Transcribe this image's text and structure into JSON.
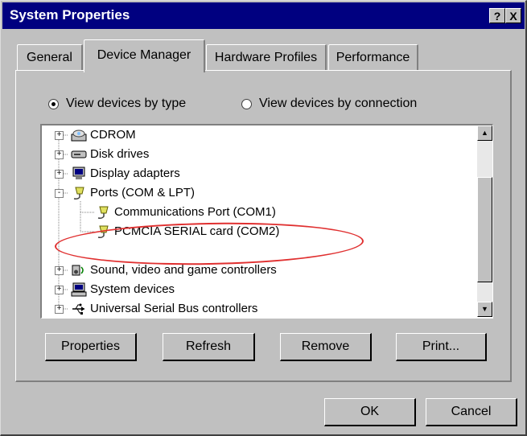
{
  "window": {
    "title": "System Properties"
  },
  "titlebar_buttons": {
    "help": "?",
    "close": "X"
  },
  "tabs": [
    "General",
    "Device Manager",
    "Hardware Profiles",
    "Performance"
  ],
  "view_options": {
    "by_type": "View devices by type",
    "by_connection": "View devices by connection",
    "selected": "by_type"
  },
  "tree": {
    "items": [
      {
        "label": "CDROM",
        "icon": "cdrom-icon",
        "expander": "+"
      },
      {
        "label": "Disk drives",
        "icon": "disk-drive-icon",
        "expander": "+"
      },
      {
        "label": "Display adapters",
        "icon": "monitor-icon",
        "expander": "+"
      },
      {
        "label": "Ports (COM & LPT)",
        "icon": "port-connector-icon",
        "expander": "-"
      },
      {
        "label": "Communications Port (COM1)",
        "icon": "port-connector-icon",
        "child": true
      },
      {
        "label": "PCMCIA SERIAL card (COM2)",
        "icon": "port-connector-icon",
        "child": true,
        "highlighted": true
      },
      {
        "label": "Sound, video and game controllers",
        "icon": "sound-icon",
        "expander": "+"
      },
      {
        "label": "System devices",
        "icon": "computer-icon",
        "expander": "+"
      },
      {
        "label": "Universal Serial Bus controllers",
        "icon": "usb-icon",
        "expander": "+"
      }
    ]
  },
  "scrollbar": {
    "up": "▲",
    "down": "▼"
  },
  "buttons": {
    "properties": "Properties",
    "refresh": "Refresh",
    "remove": "Remove",
    "print": "Print...",
    "ok": "OK",
    "cancel": "Cancel"
  },
  "colors": {
    "titlebar": "#000080",
    "face": "#c0c0c0",
    "highlight_circle": "#e03030"
  }
}
